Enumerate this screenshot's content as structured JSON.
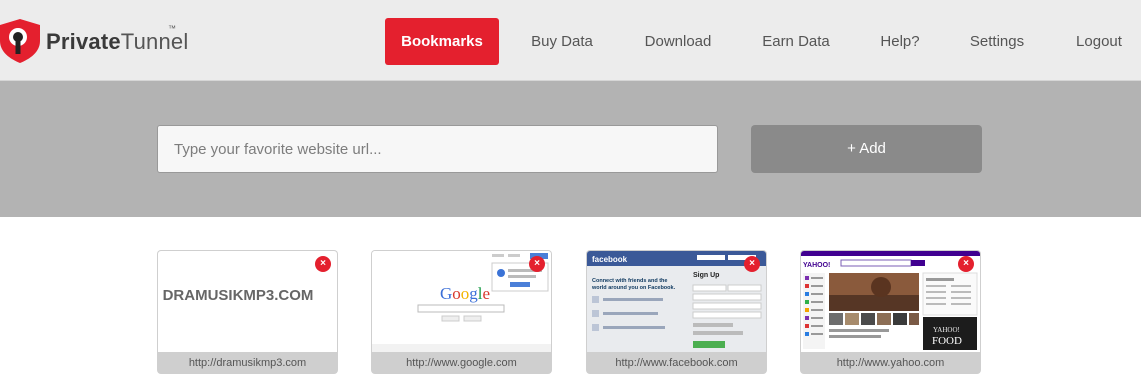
{
  "brand": {
    "name_part1": "Private",
    "name_part2": "Tunnel",
    "tm": "™",
    "accent": "#e4202e"
  },
  "nav": {
    "items": [
      {
        "label": "Bookmarks",
        "active": true
      },
      {
        "label": "Buy Data",
        "active": false
      },
      {
        "label": "Download",
        "active": false
      },
      {
        "label": "Earn Data",
        "active": false
      },
      {
        "label": "Help?",
        "active": false
      },
      {
        "label": "Settings",
        "active": false
      },
      {
        "label": "Logout",
        "active": false
      }
    ]
  },
  "addbar": {
    "placeholder": "Type your favorite website url...",
    "value": "",
    "add_label": "+ Add"
  },
  "bookmarks": [
    {
      "url": "http://dramusikmp3.com",
      "thumb_text": "DRAMUSIKMP3.COM",
      "close_icon": "×"
    },
    {
      "url": "http://www.google.com",
      "thumb_text": "Google",
      "close_icon": "×"
    },
    {
      "url": "http://www.facebook.com",
      "thumb_text": "facebook",
      "close_icon": "×"
    },
    {
      "url": "http://www.yahoo.com",
      "thumb_text": "YAHOO!",
      "close_icon": "×"
    }
  ]
}
